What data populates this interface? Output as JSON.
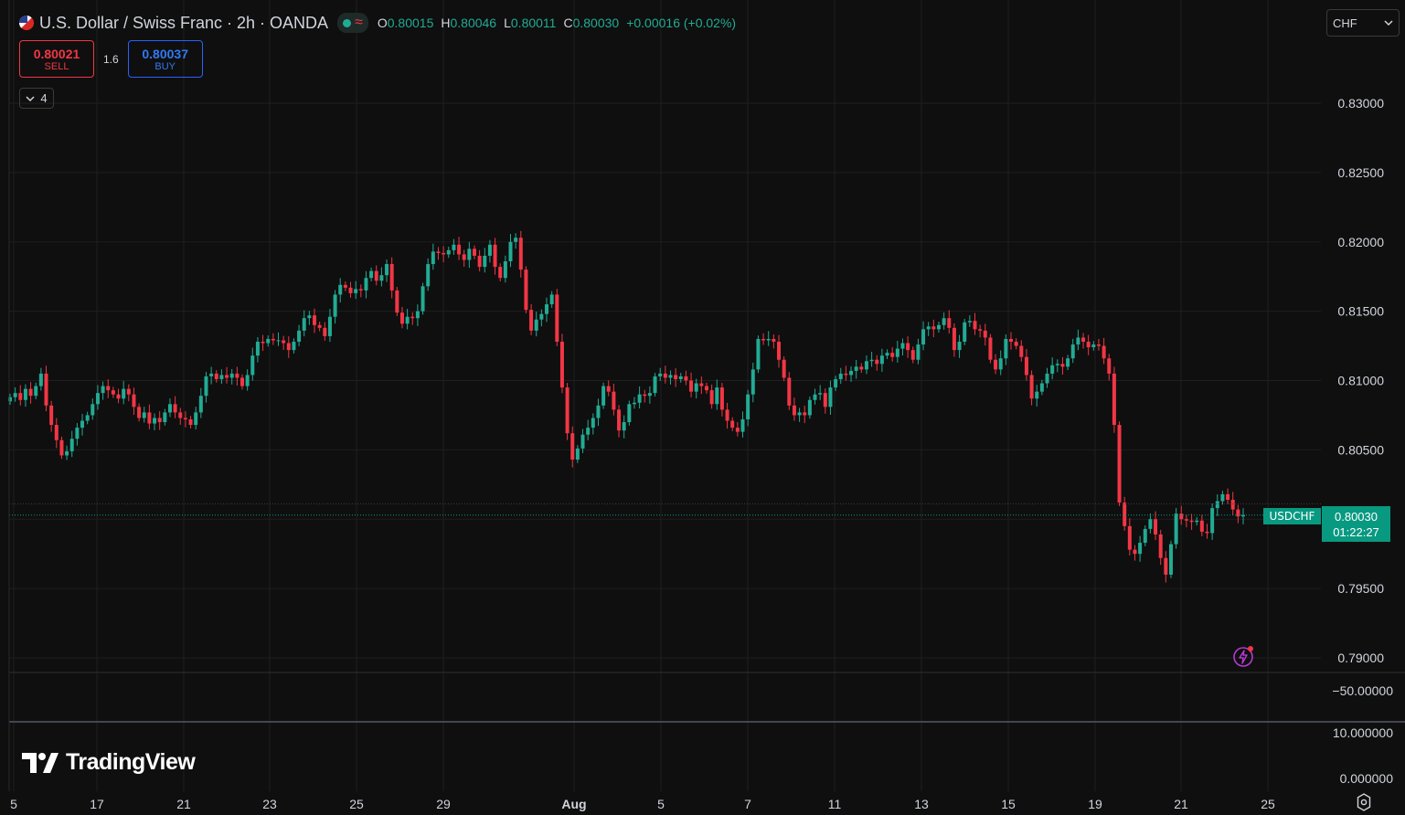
{
  "header": {
    "title": "U.S. Dollar / Swiss Franc · 2h · OANDA",
    "ohlc": [
      {
        "label": "O",
        "value": "0.80015"
      },
      {
        "label": "H",
        "value": "0.80046"
      },
      {
        "label": "L",
        "value": "0.80011"
      },
      {
        "label": "C",
        "value": "0.80030"
      }
    ],
    "change": "+0.00016 (+0.02%)"
  },
  "trading": {
    "sell_price": "0.80021",
    "sell_label": "SELL",
    "spread": "1.6",
    "buy_price": "0.80037",
    "buy_label": "BUY"
  },
  "indicators_toggle": {
    "count": "4"
  },
  "currency_select": {
    "value": "CHF"
  },
  "price_tag": {
    "symbol": "USDCHF",
    "price": "0.80030",
    "countdown": "01:22:27"
  },
  "branding": {
    "name": "TradingView"
  },
  "lower_panes": [
    {
      "ticks": [
        "−50.00000"
      ]
    },
    {
      "ticks": [
        "10.000000",
        "0.000000"
      ]
    }
  ],
  "colors": {
    "up": "#22ab94",
    "down": "#f23645",
    "background": "#0f0f0f",
    "grid": "#1f1f1f",
    "price_line": "#089981"
  },
  "icons": [
    "flag-icon",
    "chevron-down-icon",
    "lightning-icon",
    "settings-icon"
  ],
  "chart_data": {
    "type": "candlestick",
    "symbol": "USDCHF",
    "interval": "2h",
    "current_price": 0.8003,
    "y_ticks": [
      "0.83000",
      "0.82500",
      "0.82000",
      "0.81500",
      "0.81000",
      "0.80500",
      "0.80000",
      "0.79500",
      "0.79000"
    ],
    "ylim": [
      0.7887,
      0.8365
    ],
    "x_ticks": [
      "5",
      "17",
      "21",
      "23",
      "25",
      "29",
      "Aug",
      "5",
      "7",
      "11",
      "13",
      "15",
      "19",
      "21",
      "25"
    ],
    "closes": [
      0.8088,
      0.8091,
      0.8086,
      0.8094,
      0.8089,
      0.8096,
      0.8105,
      0.8082,
      0.8068,
      0.8057,
      0.8046,
      0.8049,
      0.8058,
      0.8066,
      0.8071,
      0.8075,
      0.8083,
      0.8091,
      0.8096,
      0.8093,
      0.809,
      0.8087,
      0.8094,
      0.809,
      0.8081,
      0.8073,
      0.8077,
      0.8069,
      0.8073,
      0.807,
      0.8077,
      0.8083,
      0.8077,
      0.8073,
      0.8072,
      0.8068,
      0.8077,
      0.8089,
      0.8103,
      0.8105,
      0.8101,
      0.8104,
      0.8102,
      0.8105,
      0.8102,
      0.8096,
      0.8104,
      0.8118,
      0.8128,
      0.8127,
      0.813,
      0.8129,
      0.8129,
      0.8127,
      0.8122,
      0.8128,
      0.8136,
      0.8145,
      0.8147,
      0.814,
      0.8138,
      0.8132,
      0.8146,
      0.8162,
      0.8169,
      0.8167,
      0.8163,
      0.8166,
      0.8165,
      0.8174,
      0.8179,
      0.8172,
      0.8176,
      0.8184,
      0.8165,
      0.8149,
      0.8141,
      0.8146,
      0.8145,
      0.815,
      0.8168,
      0.8184,
      0.8193,
      0.8192,
      0.8191,
      0.8194,
      0.8198,
      0.8191,
      0.8187,
      0.8195,
      0.819,
      0.8182,
      0.819,
      0.8198,
      0.8182,
      0.8174,
      0.8186,
      0.82,
      0.8203,
      0.818,
      0.8151,
      0.8136,
      0.8144,
      0.8148,
      0.8155,
      0.8162,
      0.8128,
      0.8095,
      0.8062,
      0.8043,
      0.8051,
      0.8061,
      0.8066,
      0.8073,
      0.8082,
      0.8096,
      0.8092,
      0.8079,
      0.8064,
      0.807,
      0.8083,
      0.8084,
      0.809,
      0.8089,
      0.8091,
      0.8103,
      0.8105,
      0.8102,
      0.8104,
      0.8101,
      0.8103,
      0.81,
      0.8092,
      0.8098,
      0.8096,
      0.8093,
      0.8083,
      0.8095,
      0.8079,
      0.8071,
      0.8066,
      0.8063,
      0.8072,
      0.809,
      0.8108,
      0.813,
      0.8129,
      0.813,
      0.8128,
      0.8115,
      0.8102,
      0.8082,
      0.8075,
      0.8077,
      0.8075,
      0.8086,
      0.809,
      0.8091,
      0.8081,
      0.8095,
      0.8101,
      0.8105,
      0.8104,
      0.8107,
      0.811,
      0.8108,
      0.8114,
      0.8115,
      0.8112,
      0.8118,
      0.812,
      0.8117,
      0.8123,
      0.8127,
      0.8122,
      0.8115,
      0.8126,
      0.8137,
      0.8139,
      0.8137,
      0.814,
      0.8145,
      0.8138,
      0.8122,
      0.8128,
      0.8142,
      0.8143,
      0.8137,
      0.8136,
      0.8131,
      0.8115,
      0.8108,
      0.8116,
      0.813,
      0.8128,
      0.8125,
      0.8117,
      0.8104,
      0.8087,
      0.8092,
      0.8098,
      0.8105,
      0.8111,
      0.8112,
      0.811,
      0.8116,
      0.8126,
      0.8131,
      0.8128,
      0.8124,
      0.8126,
      0.8125,
      0.8116,
      0.8105,
      0.8068,
      0.8012,
      0.7995,
      0.7978,
      0.7975,
      0.7983,
      0.7993,
      0.8,
      0.7989,
      0.7972,
      0.796,
      0.7982,
      0.8004,
      0.8,
      0.7999,
      0.7998,
      0.7999,
      0.7991,
      0.799,
      0.8008,
      0.8013,
      0.8018,
      0.8014,
      0.8007,
      0.8002,
      0.8003
    ]
  }
}
